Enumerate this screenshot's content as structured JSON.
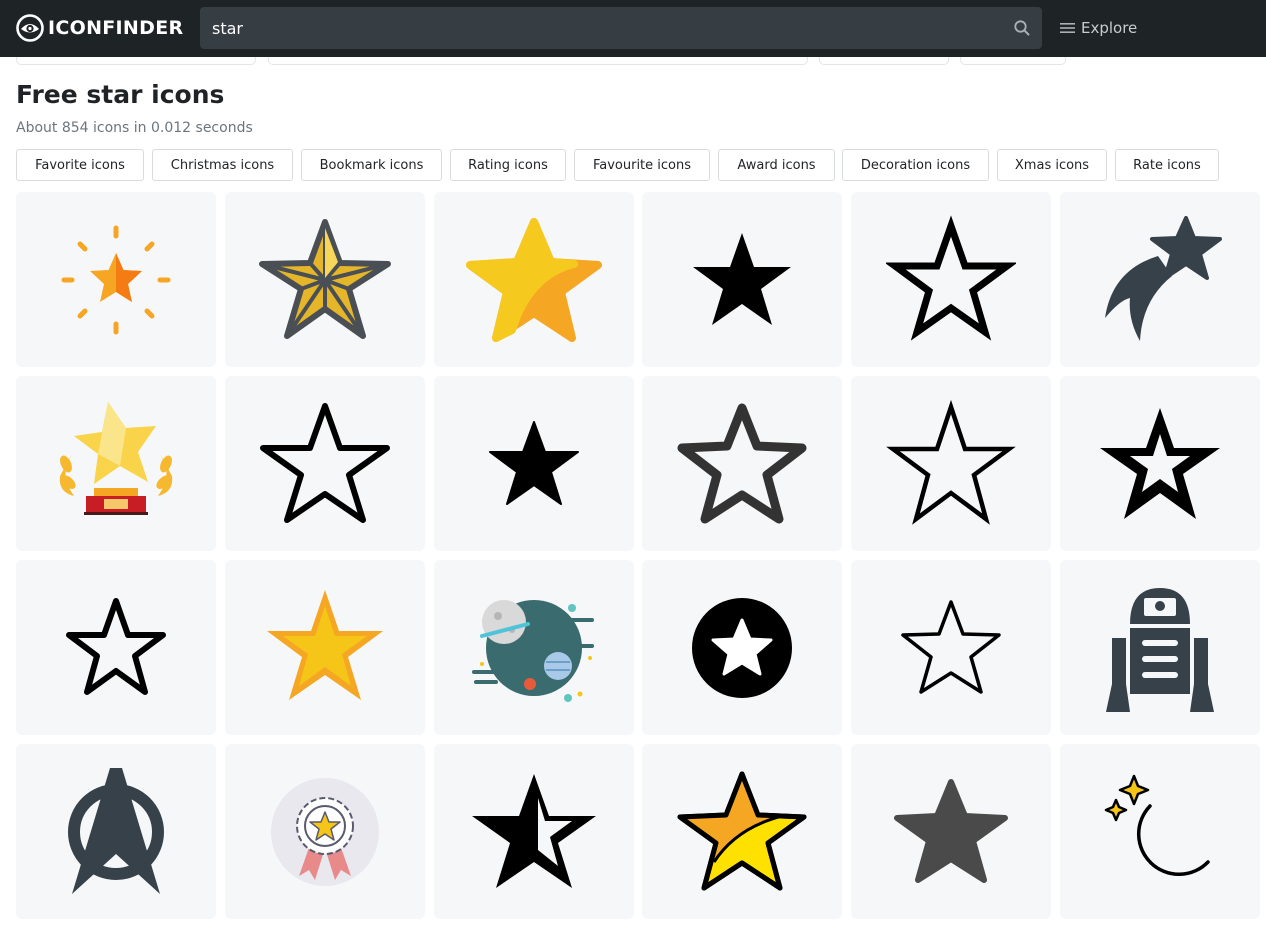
{
  "header": {
    "logo_text": "ICONFINDER",
    "search": {
      "value": "star",
      "placeholder": ""
    },
    "explore_label": "Explore"
  },
  "results": {
    "title": "Free star icons",
    "meta": "About 854 icons in 0.012 seconds"
  },
  "related_tags": [
    "Favorite icons",
    "Christmas icons",
    "Bookmark icons",
    "Rating icons",
    "Favourite icons",
    "Award icons",
    "Decoration icons",
    "Xmas icons",
    "Rate icons"
  ],
  "icons": [
    "sparkling-star-icon",
    "faceted-star-icon",
    "glossy-yellow-star-icon",
    "solid-black-star-icon",
    "outline-star-icon",
    "shooting-star-icon",
    "star-trophy-icon",
    "thin-outline-star-icon",
    "small-solid-star-icon",
    "rounded-outline-star-icon",
    "outline-star-icon",
    "double-outline-star-icon",
    "outline-star-icon",
    "gold-star-icon",
    "space-planets-icon",
    "star-in-circle-icon",
    "thin-outline-star-icon",
    "robot-droid-icon",
    "starfleet-badge-icon",
    "award-rosette-icon",
    "half-star-icon",
    "cartoon-star-icon",
    "rounded-gray-star-icon",
    "moon-and-stars-icon"
  ],
  "colors": {
    "topbar": "#1e2326",
    "search_bg": "#363d43",
    "cell_bg": "#f6f7f8",
    "dark_icon": "#37414a",
    "gold": "#f5c518",
    "orange": "#f6a623"
  }
}
